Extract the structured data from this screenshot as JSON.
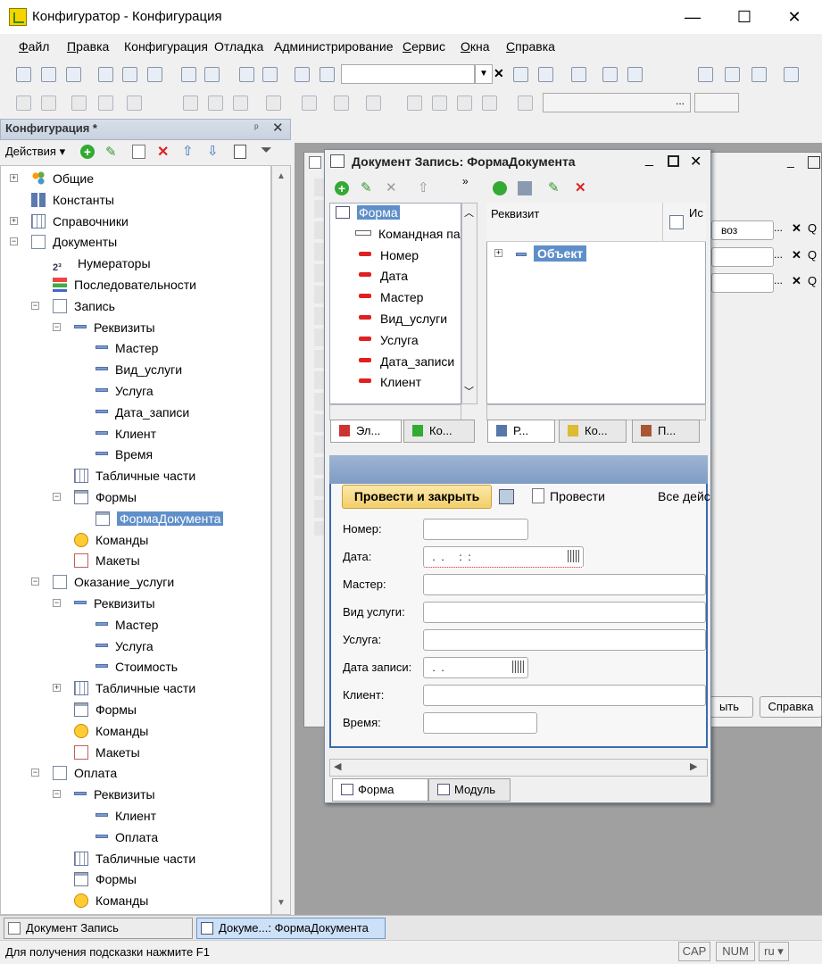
{
  "window": {
    "title": "Конфигуратор - Конфигурация",
    "min": "—",
    "max": "☐",
    "close": "✕"
  },
  "menu": [
    {
      "u": "Ф",
      "rest": "айл"
    },
    {
      "u": "П",
      "rest": "равка"
    },
    {
      "u": "",
      "rest": "Конфигурация"
    },
    {
      "u": "",
      "rest": "Отладка"
    },
    {
      "u": "",
      "rest": "Администрирование"
    },
    {
      "u": "С",
      "rest": "ервис"
    },
    {
      "u": "О",
      "rest": "кна"
    },
    {
      "u": "С",
      "rest": "правка"
    }
  ],
  "left_panel": {
    "title": "Конфигурация *",
    "actions_label": "Действия ▾",
    "tree": [
      {
        "label": "Общие",
        "level": 0,
        "icon": "gen",
        "exp": "+"
      },
      {
        "label": "Константы",
        "level": 0,
        "icon": "const",
        "exp": ""
      },
      {
        "label": "Справочники",
        "level": 0,
        "icon": "grid",
        "exp": "+"
      },
      {
        "label": "Документы",
        "level": 0,
        "icon": "doc",
        "exp": "−"
      },
      {
        "label": "Нумераторы",
        "level": 1,
        "icon": "num",
        "exp": ""
      },
      {
        "label": "Последовательности",
        "level": 1,
        "icon": "seq",
        "exp": ""
      },
      {
        "label": "Запись",
        "level": 1,
        "icon": "doc",
        "exp": "−"
      },
      {
        "label": "Реквизиты",
        "level": 2,
        "icon": "dash",
        "exp": "−"
      },
      {
        "label": "Мастер",
        "level": 3,
        "icon": "dash",
        "exp": ""
      },
      {
        "label": "Вид_услуги",
        "level": 3,
        "icon": "dash",
        "exp": ""
      },
      {
        "label": "Услуга",
        "level": 3,
        "icon": "dash",
        "exp": ""
      },
      {
        "label": "Дата_записи",
        "level": 3,
        "icon": "dash",
        "exp": ""
      },
      {
        "label": "Клиент",
        "level": 3,
        "icon": "dash",
        "exp": ""
      },
      {
        "label": "Время",
        "level": 3,
        "icon": "dash",
        "exp": ""
      },
      {
        "label": "Табличные части",
        "level": 2,
        "icon": "grid",
        "exp": ""
      },
      {
        "label": "Формы",
        "level": 2,
        "icon": "form",
        "exp": "−"
      },
      {
        "label": "ФормаДокумента",
        "level": 3,
        "icon": "form",
        "exp": "",
        "selected": true
      },
      {
        "label": "Команды",
        "level": 2,
        "icon": "cmd",
        "exp": ""
      },
      {
        "label": "Макеты",
        "level": 2,
        "icon": "mak",
        "exp": ""
      },
      {
        "label": "Оказание_услуги",
        "level": 1,
        "icon": "doc",
        "exp": "−"
      },
      {
        "label": "Реквизиты",
        "level": 2,
        "icon": "dash",
        "exp": "−"
      },
      {
        "label": "Мастер",
        "level": 3,
        "icon": "dash",
        "exp": ""
      },
      {
        "label": "Услуга",
        "level": 3,
        "icon": "dash",
        "exp": ""
      },
      {
        "label": "Стоимость",
        "level": 3,
        "icon": "dash",
        "exp": ""
      },
      {
        "label": "Табличные части",
        "level": 2,
        "icon": "grid",
        "exp": "+"
      },
      {
        "label": "Формы",
        "level": 2,
        "icon": "form",
        "exp": ""
      },
      {
        "label": "Команды",
        "level": 2,
        "icon": "cmd",
        "exp": ""
      },
      {
        "label": "Макеты",
        "level": 2,
        "icon": "mak",
        "exp": ""
      },
      {
        "label": "Оплата",
        "level": 1,
        "icon": "doc",
        "exp": "−"
      },
      {
        "label": "Реквизиты",
        "level": 2,
        "icon": "dash",
        "exp": "−"
      },
      {
        "label": "Клиент",
        "level": 3,
        "icon": "dash",
        "exp": ""
      },
      {
        "label": "Оплата",
        "level": 3,
        "icon": "dash",
        "exp": ""
      },
      {
        "label": "Табличные части",
        "level": 2,
        "icon": "grid",
        "exp": ""
      },
      {
        "label": "Формы",
        "level": 2,
        "icon": "form",
        "exp": ""
      },
      {
        "label": "Команды",
        "level": 2,
        "icon": "cmd",
        "exp": ""
      }
    ]
  },
  "doc_window": {
    "title": "Документ Запись: ФормаДокумента",
    "elements": [
      {
        "label": "Форма",
        "icon": "form",
        "selected": true
      },
      {
        "label": "Командная па",
        "icon": "cmdbar"
      },
      {
        "label": "Номер",
        "icon": "red"
      },
      {
        "label": "Дата",
        "icon": "red"
      },
      {
        "label": "Мастер",
        "icon": "red"
      },
      {
        "label": "Вид_услуги",
        "icon": "red"
      },
      {
        "label": "Услуга",
        "icon": "red"
      },
      {
        "label": "Дата_записи",
        "icon": "red"
      },
      {
        "label": "Клиент",
        "icon": "red"
      }
    ],
    "left_tabs": [
      "Эл...",
      "Ко..."
    ],
    "attr_header": "Реквизит",
    "attr_header2": "Ис",
    "attr_header3": "воз",
    "attr_item": "Объект",
    "right_tabs": [
      "Р...",
      "Ко...",
      "П..."
    ],
    "form": {
      "post_close": "Провести и закрыть",
      "post": "Провести",
      "all_actions": "Все дейс",
      "fields": [
        {
          "label": "Номер:",
          "value": ""
        },
        {
          "label": "Дата:",
          "value": " .  .     :  :"
        },
        {
          "label": "Мастер:",
          "value": ""
        },
        {
          "label": "Вид услуги:",
          "value": ""
        },
        {
          "label": "Услуга:",
          "value": ""
        },
        {
          "label": "Дата записи:",
          "value": " .  ."
        },
        {
          "label": "Клиент:",
          "value": ""
        },
        {
          "label": "Время:",
          "value": ""
        }
      ]
    },
    "bottom_tabs": [
      "Форма",
      "Модуль"
    ]
  },
  "background_window": {
    "btn1": "ыть",
    "btn2": "Справка"
  },
  "taskbar": [
    "Документ Запись",
    "Докуме...: ФормаДокумента"
  ],
  "status": {
    "hint": "Для получения подсказки нажмите F1",
    "cap": "CAP",
    "num": "NUM",
    "lang": "ru ▾"
  }
}
